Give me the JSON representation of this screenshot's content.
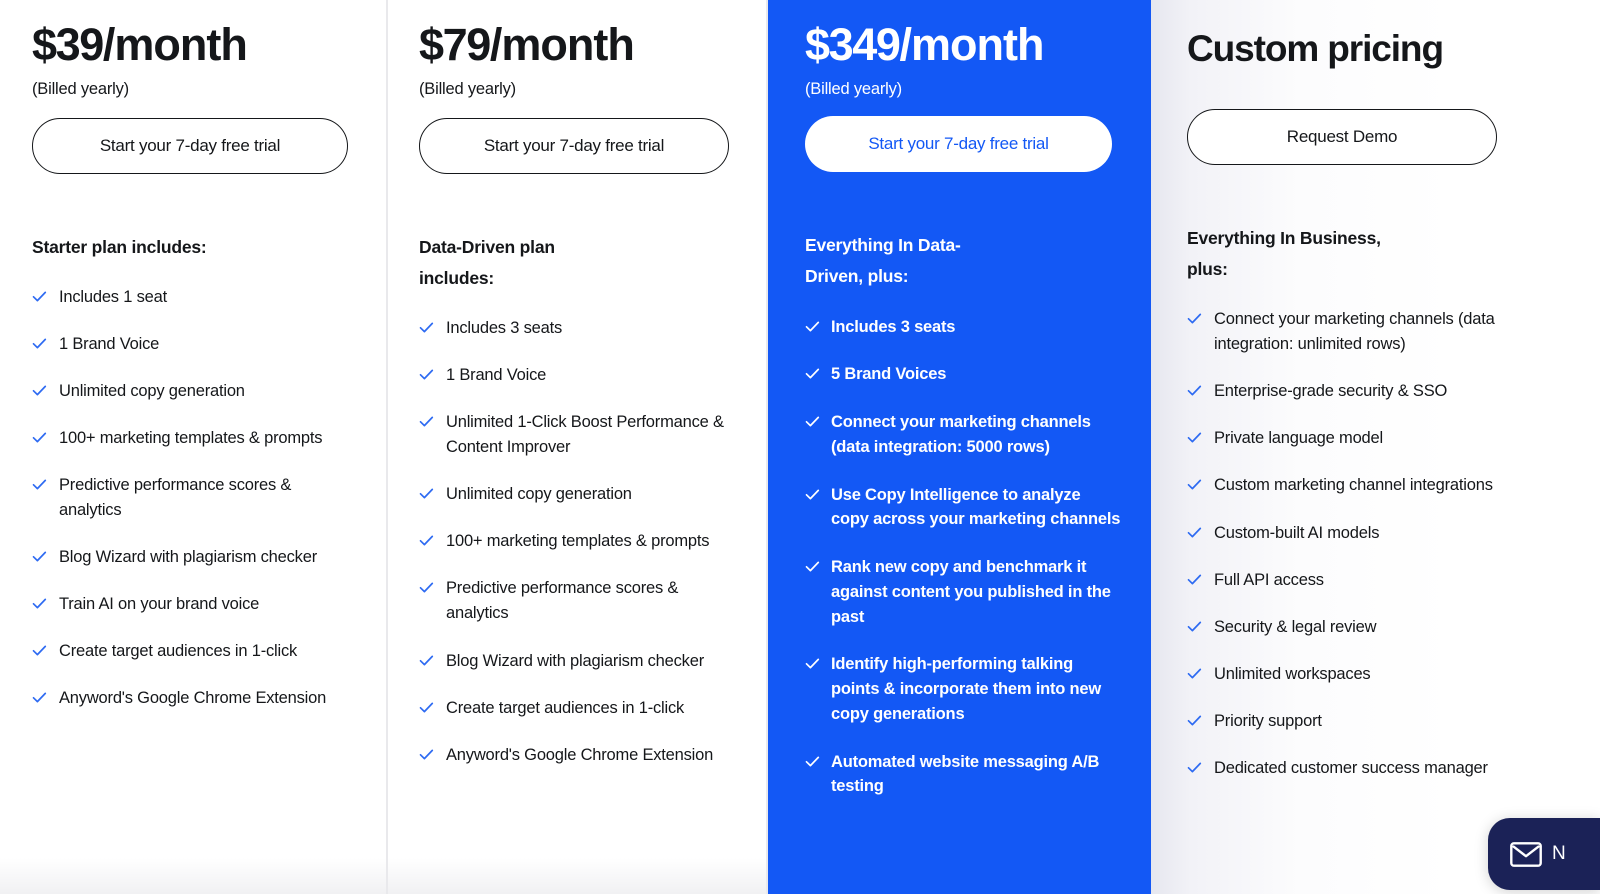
{
  "brand": {
    "accent_blue": "#1358F5",
    "check_blue": "#2E6BF2",
    "text_dark": "#15171a",
    "chat_navy": "#1b2257"
  },
  "plans": [
    {
      "id": "starter",
      "price_amount": "$39",
      "price_period": "/month",
      "billing_note": "(Billed yearly)",
      "cta_label": "Start your 7-day free trial",
      "features_heading": "Starter plan includes:",
      "features": [
        "Includes 1 seat",
        "1 Brand Voice",
        "Unlimited copy generation",
        "100+ marketing templates & prompts",
        "Predictive performance scores & analytics",
        "Blog Wizard with plagiarism checker",
        "Train AI on your brand voice",
        "Create target audiences in 1-click",
        "Anyword's Google Chrome Extension"
      ]
    },
    {
      "id": "data-driven",
      "price_amount": "$79",
      "price_period": "/month",
      "billing_note": "(Billed yearly)",
      "cta_label": "Start your 7-day free trial",
      "features_heading": "Data-Driven plan includes:",
      "features": [
        "Includes 3 seats",
        "1 Brand Voice",
        "Unlimited 1-Click Boost Performance & Content Improver",
        "Unlimited copy generation",
        "100+ marketing templates & prompts",
        "Predictive performance scores & analytics",
        "Blog Wizard with plagiarism checker",
        "Create target audiences in 1-click",
        "Anyword's Google Chrome Extension"
      ]
    },
    {
      "id": "business",
      "price_amount": "$349",
      "price_period": "/month",
      "billing_note": "(Billed yearly)",
      "cta_label": "Start your 7-day free trial",
      "features_heading": "Everything In Data-Driven, plus:",
      "features": [
        "Includes 3 seats",
        "5 Brand Voices",
        "Connect your marketing channels (data integration: 5000 rows)",
        "Use Copy Intelligence to analyze copy across your marketing channels",
        "Rank new copy and benchmark it against content you published in the past",
        "Identify high-performing talking points & incorporate them into new copy generations",
        "Automated website messaging A/B testing"
      ]
    },
    {
      "id": "custom",
      "title": "Custom pricing",
      "cta_label": "Request Demo",
      "features_heading": "Everything In Business, plus:",
      "features": [
        "Connect your marketing channels (data integration: unlimited rows)",
        "Enterprise-grade security & SSO",
        "Private language model",
        "Custom marketing channel integrations",
        "Custom-built AI models",
        "Full API access",
        "Security & legal review",
        "Unlimited workspaces",
        "Priority support",
        "Dedicated customer success manager"
      ]
    }
  ],
  "chat_widget": {
    "label": "N"
  }
}
